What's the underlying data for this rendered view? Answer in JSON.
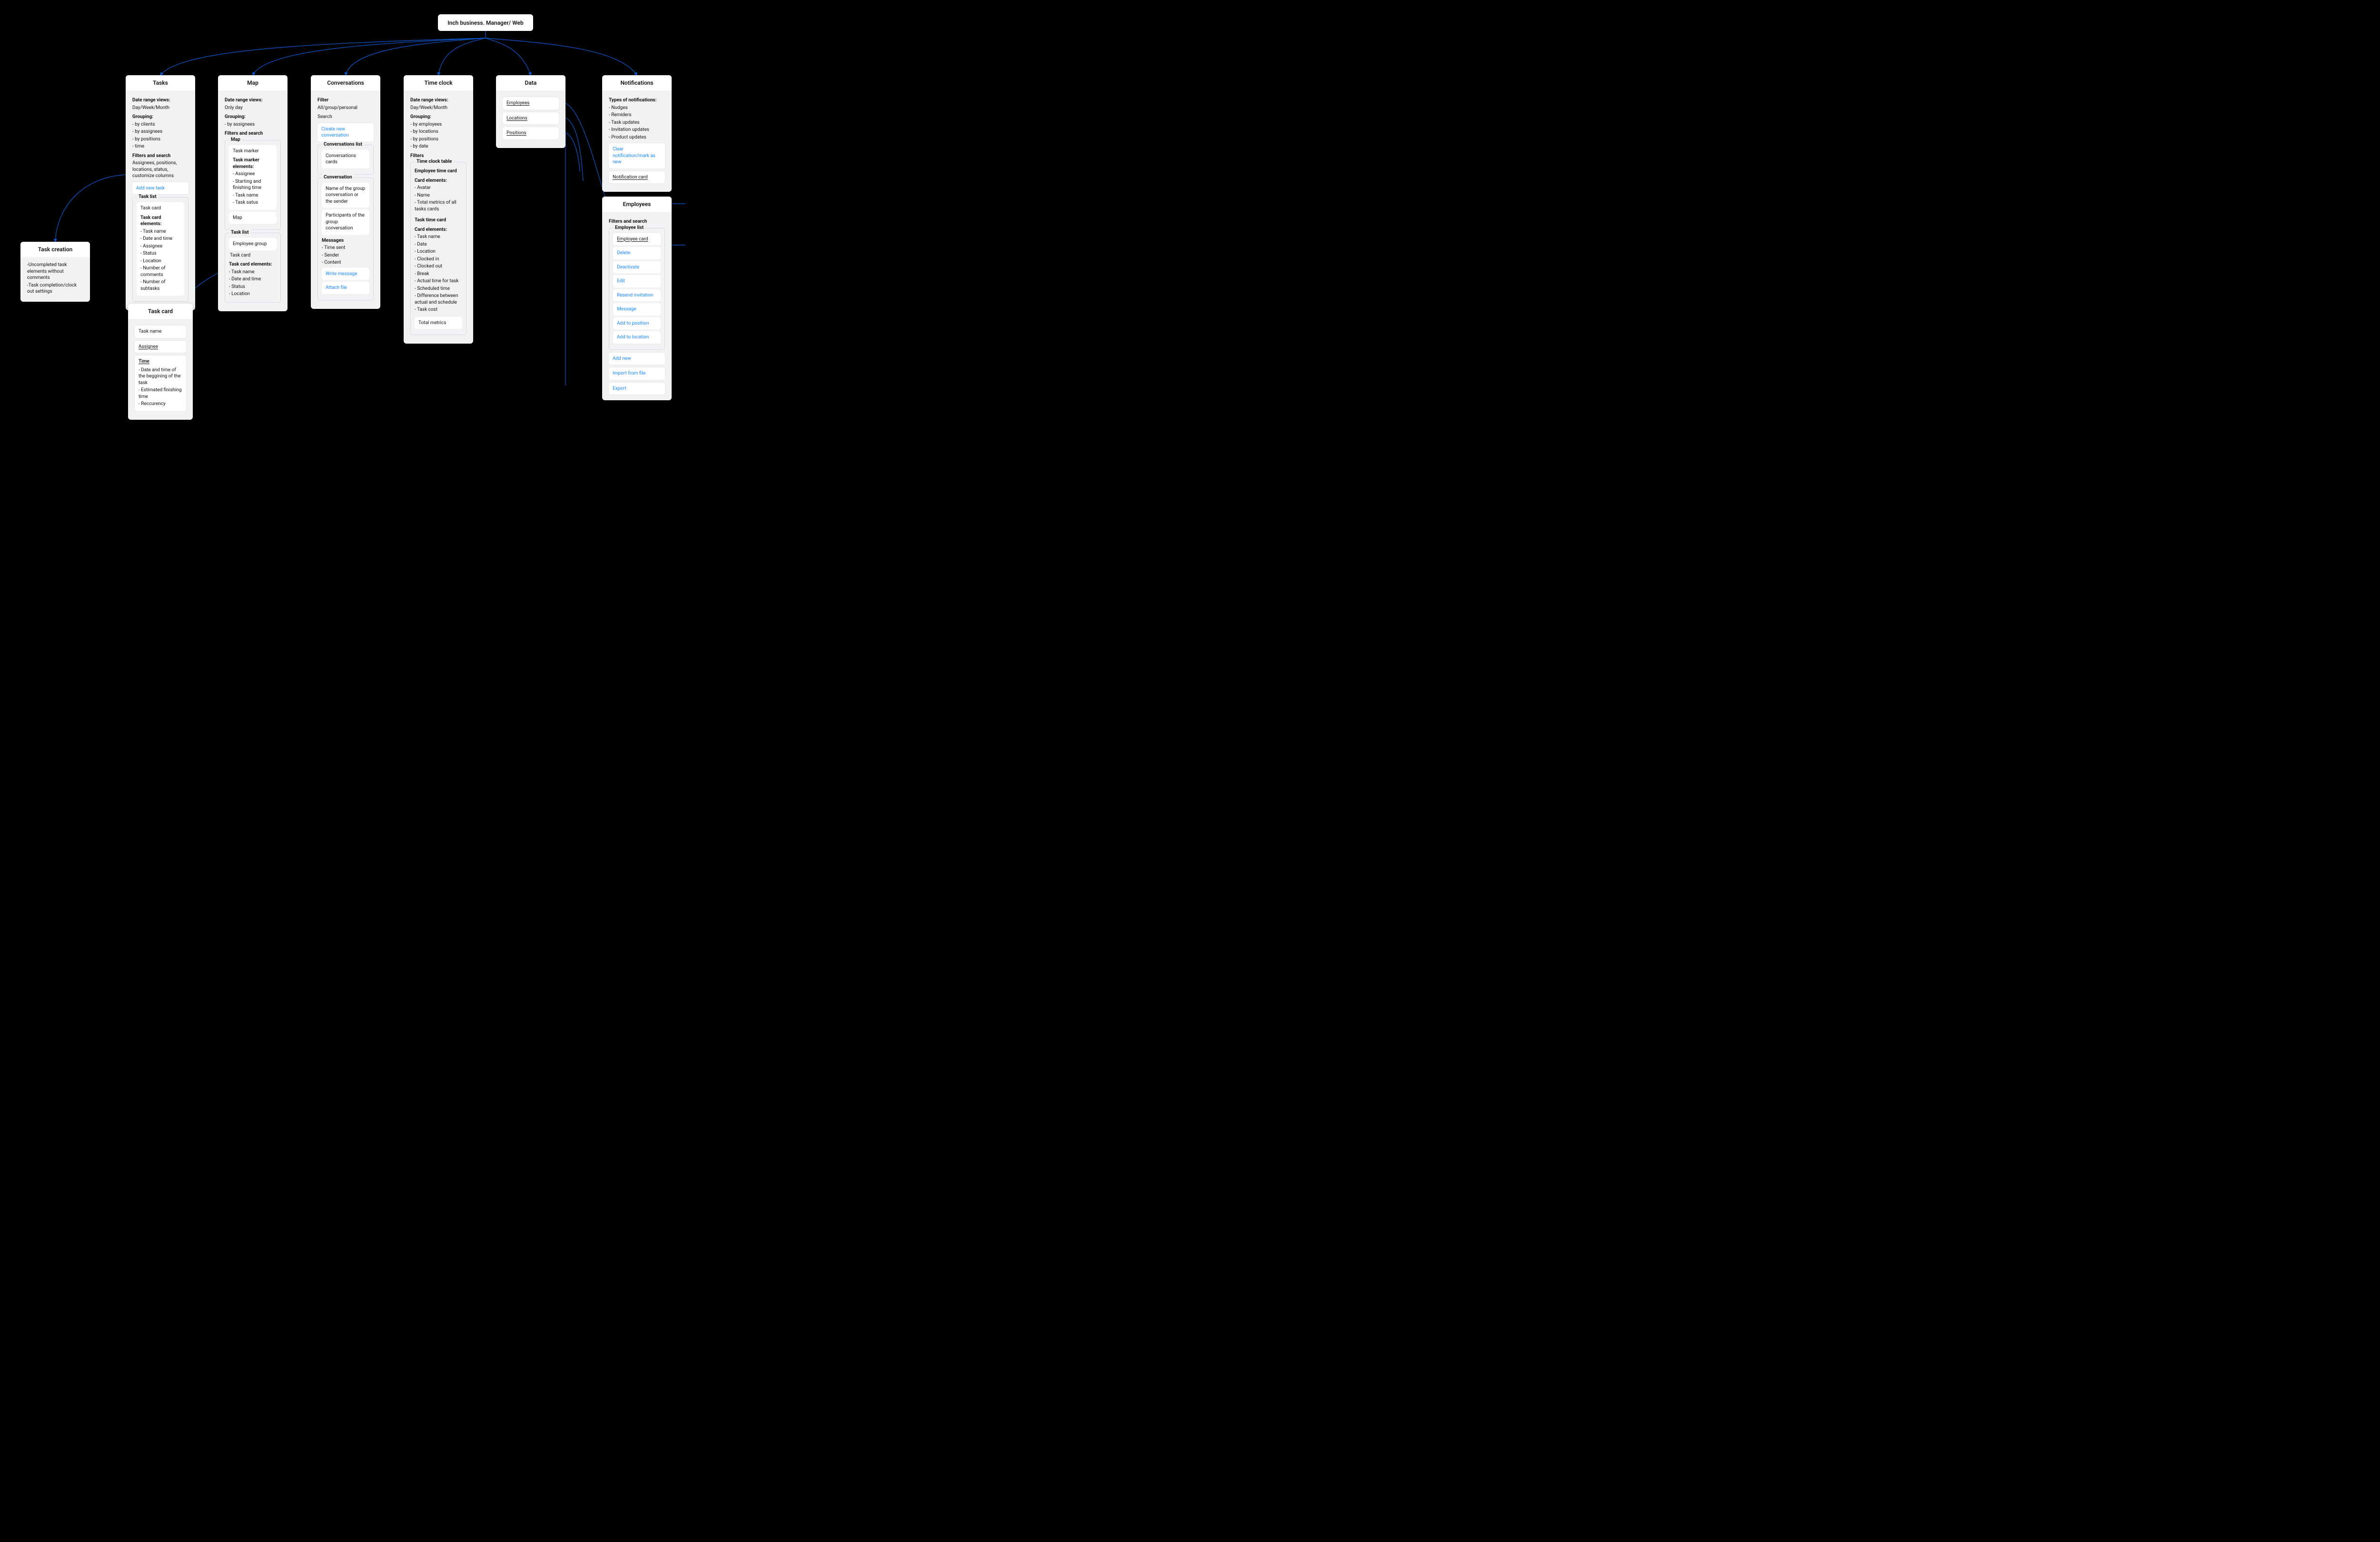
{
  "root": {
    "title": "Inch business. Manager/ Web"
  },
  "tasks": {
    "title": "Tasks",
    "date_range_label": "Date range views:",
    "date_range_value": "Day/Week/Month",
    "grouping_label": "Grouping:",
    "grouping_items": [
      "- by clients",
      "- by assignees",
      "- by positions",
      "- time"
    ],
    "filters_label": "Filters and search",
    "filters_desc": "Assignees, positions, locations, status, customize columns",
    "add_new_task": "Add new task",
    "task_list_legend": "Task list",
    "task_card_title": "Task card",
    "task_card_elements_label": "Task card elements:",
    "task_card_elements": [
      "- Task name",
      "- Date and time",
      "- Assignee",
      "- Status",
      "- Location",
      "- Number of comments",
      "- Number of subtasks"
    ]
  },
  "map": {
    "title": "Map",
    "date_range_label": "Date range views:",
    "date_range_value": "Only day",
    "grouping_label": "Grouping:",
    "grouping_items": [
      "- by assignees"
    ],
    "filters_label": "Filters and search",
    "map_legend": "Map",
    "task_marker_title": "Task marker",
    "marker_elements_label": "Task marker elements:",
    "marker_elements": [
      "- Assignee",
      "- Starting and finishing time",
      "- Task name",
      "- Task satus"
    ],
    "map_text": "Map",
    "task_list_legend": "Task list",
    "employee_group": "Employee group",
    "task_card_title": "Task card",
    "task_card_elements_label": "Task card elements:",
    "task_card_elements": [
      "- Task name",
      "- Date and time",
      "- Status",
      "- Location"
    ]
  },
  "convs": {
    "title": "Conversations",
    "filter_label": "Filter",
    "filter_value": "All/group/personal",
    "search": "Search",
    "create_new": "Create new conversation",
    "conv_list_legend": "Conversations list",
    "conv_cards": "Conversations cards",
    "conversation_legend": "Conversation",
    "conv_name": "Name of the group conversation or the sender",
    "conv_participants": "Participants of the group conversation",
    "messages_label": "Messages",
    "messages_items": [
      "- Time sent",
      "- Sender",
      "- Content"
    ],
    "write_message": "Write message",
    "attach_file": "Attach file"
  },
  "tclock": {
    "title": "Time clock",
    "date_range_label": "Date range views:",
    "date_range_value": "Day/Week/Month",
    "grouping_label": "Grouping:",
    "grouping_items": [
      "- by employees",
      "- by locations",
      "- by positions",
      "- by date"
    ],
    "filters": "Filters",
    "table_legend": "Time clock table",
    "emp_timecard_title": "Employee time card",
    "emp_card_elements_label": "Card elements:",
    "emp_card_elements": [
      "- Avatar",
      "- Name",
      "- Total metrics of all tasks cards"
    ],
    "task_timecard_title": "Task time card",
    "task_card_elements_label": "Card elements:",
    "task_card_elements": [
      "- Task name",
      "- Date",
      "- Location",
      "- Clocked in",
      "- Clocked out",
      "- Break",
      "- Actual time for task",
      "- Scheduled time",
      "- Difference between actual and schedule",
      "- Task cost"
    ],
    "total_metrics": "Total metrics"
  },
  "data": {
    "title": "Data",
    "employees": "Employees",
    "locations": "Locations",
    "positions": "Positions"
  },
  "notif": {
    "title": "Notifications",
    "types_label": "Types of notifications:",
    "types": [
      "- Nudges",
      "- Remiders",
      "- Task updates",
      "- Invitation updates",
      "- Product updates"
    ],
    "clear": "Clear notification/mark as new",
    "notif_card": "Notification card"
  },
  "taskcreate": {
    "title": "Task creation",
    "line1": "-Uncompleted task elements without comments",
    "line2": "-Task completion/clock out settings"
  },
  "taskcard": {
    "title": "Task card",
    "task_name": "Task name",
    "assignee": "Assignee",
    "time": "Time",
    "time_items": [
      "- Date and time of the beggining of the task",
      "- Estimated finishing time",
      "- Reccurency"
    ]
  },
  "employees": {
    "title": "Employees",
    "filters": "Filters and search",
    "list_legend": "Employee list",
    "employee_card": "Employee card",
    "actions": [
      "Delete",
      "Deactivate",
      "Edit",
      "Resend invitation",
      "Message",
      "Add to position",
      "Add to location"
    ],
    "add_new": "Add new",
    "import_file": "Import from file",
    "export": "Export"
  }
}
